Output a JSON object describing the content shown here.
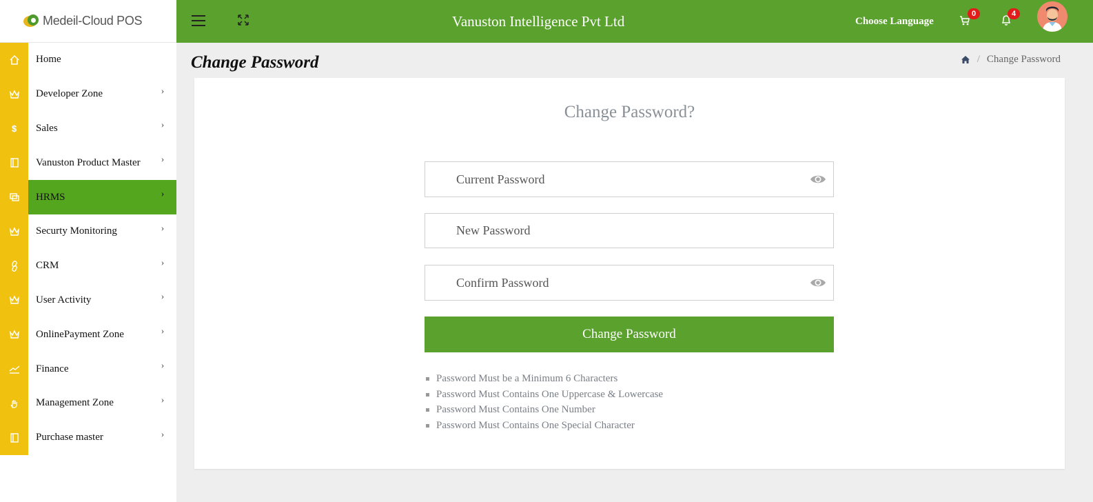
{
  "brand": {
    "name": "Medeil-Cloud POS"
  },
  "header": {
    "company": "Vanuston Intelligence Pvt Ltd",
    "choose_language": "Choose Language",
    "cart_count": "0",
    "notification_count": "4"
  },
  "sidebar": {
    "items": [
      {
        "label": "Home",
        "icon": "home-icon"
      },
      {
        "label": "Developer Zone",
        "icon": "crown-icon"
      },
      {
        "label": "Sales",
        "icon": "dollar-icon"
      },
      {
        "label": "Vanuston Product Master",
        "icon": "book-icon"
      },
      {
        "label": "HRMS",
        "icon": "copy-icon",
        "active": true
      },
      {
        "label": "Securty Monitoring",
        "icon": "crown-icon"
      },
      {
        "label": "CRM",
        "icon": "link-icon"
      },
      {
        "label": "User Activity",
        "icon": "crown-icon"
      },
      {
        "label": "OnlinePayment Zone",
        "icon": "crown-icon"
      },
      {
        "label": "Finance",
        "icon": "trend-icon"
      },
      {
        "label": "Management Zone",
        "icon": "hand-icon"
      },
      {
        "label": "Purchase master",
        "icon": "book-icon"
      }
    ]
  },
  "page": {
    "title": "Change Password",
    "breadcrumb_current": "Change Password",
    "breadcrumb_sep": "/"
  },
  "form": {
    "heading": "Change Password?",
    "current_placeholder": "Current Password",
    "new_placeholder": "New Password",
    "confirm_placeholder": "Confirm Password",
    "submit_label": "Change Password",
    "rules": [
      "Password Must be a Minimum 6 Characters",
      "Password Must Contains One Uppercase & Lowercase",
      "Password Must Contains One Number",
      "Password Must Contains One Special Character"
    ]
  },
  "colors": {
    "primary_green": "#5aa12d",
    "active_green": "#55a61f",
    "sidebar_yellow": "#f0c20f",
    "badge_red": "#e21b1b"
  }
}
